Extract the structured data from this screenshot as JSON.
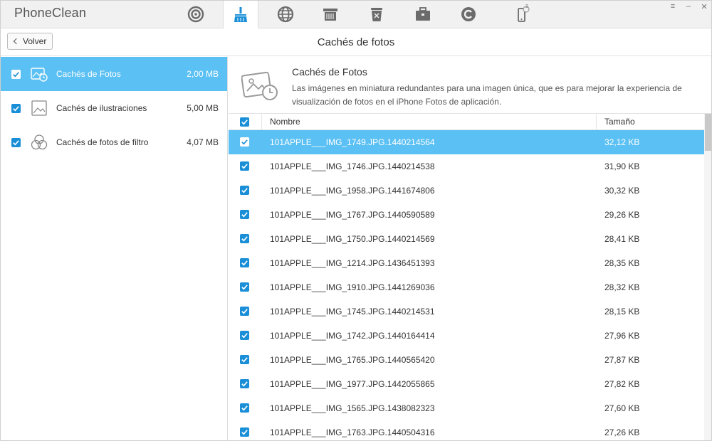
{
  "app": {
    "title": "PhoneClean"
  },
  "toolbar": {
    "icons": [
      "quick-clean-icon",
      "deep-clean-icon",
      "internet-clean-icon",
      "privacy-clean-icon",
      "trash-icon",
      "toolbox-icon",
      "silent-clean-icon",
      "device-icon"
    ],
    "active_index": 1,
    "device_badge": "2",
    "accent": "#1a8fd8"
  },
  "window_controls": {
    "menu": "≡",
    "minimize": "–",
    "close": "✕"
  },
  "header": {
    "back_label": "Volver",
    "title": "Cachés de fotos"
  },
  "sidebar": {
    "items": [
      {
        "label": "Cachés de Fotos",
        "size": "2,00 MB",
        "selected": true,
        "icon": "photo-cache-icon"
      },
      {
        "label": "Cachés de ilustraciones",
        "size": "5,00 MB",
        "selected": false,
        "icon": "illustration-cache-icon"
      },
      {
        "label": "Cachés de fotos de filtro",
        "size": "4,07 MB",
        "selected": false,
        "icon": "filter-cache-icon"
      }
    ],
    "selected_color": "#5bc0f3"
  },
  "content": {
    "title": "Cachés de Fotos",
    "description": "Las imágenes en miniatura redundantes para una imagen única, que es para mejorar la experiencia de visualización de fotos en el iPhone Fotos de aplicación."
  },
  "table": {
    "columns": {
      "name": "Nombre",
      "size": "Tamaño"
    },
    "rows": [
      {
        "name": "101APPLE___IMG_1749.JPG.1440214564",
        "size": "32,12 KB",
        "selected": true
      },
      {
        "name": "101APPLE___IMG_1746.JPG.1440214538",
        "size": "31,90 KB",
        "selected": false
      },
      {
        "name": "101APPLE___IMG_1958.JPG.1441674806",
        "size": "30,32 KB",
        "selected": false
      },
      {
        "name": "101APPLE___IMG_1767.JPG.1440590589",
        "size": "29,26 KB",
        "selected": false
      },
      {
        "name": "101APPLE___IMG_1750.JPG.1440214569",
        "size": "28,41 KB",
        "selected": false
      },
      {
        "name": "101APPLE___IMG_1214.JPG.1436451393",
        "size": "28,35 KB",
        "selected": false
      },
      {
        "name": "101APPLE___IMG_1910.JPG.1441269036",
        "size": "28,32 KB",
        "selected": false
      },
      {
        "name": "101APPLE___IMG_1745.JPG.1440214531",
        "size": "28,15 KB",
        "selected": false
      },
      {
        "name": "101APPLE___IMG_1742.JPG.1440164414",
        "size": "27,96 KB",
        "selected": false
      },
      {
        "name": "101APPLE___IMG_1765.JPG.1440565420",
        "size": "27,87 KB",
        "selected": false
      },
      {
        "name": "101APPLE___IMG_1977.JPG.1442055865",
        "size": "27,82 KB",
        "selected": false
      },
      {
        "name": "101APPLE___IMG_1565.JPG.1438082323",
        "size": "27,60 KB",
        "selected": false
      },
      {
        "name": "101APPLE___IMG_1763.JPG.1440504316",
        "size": "27,26 KB",
        "selected": false
      }
    ]
  }
}
